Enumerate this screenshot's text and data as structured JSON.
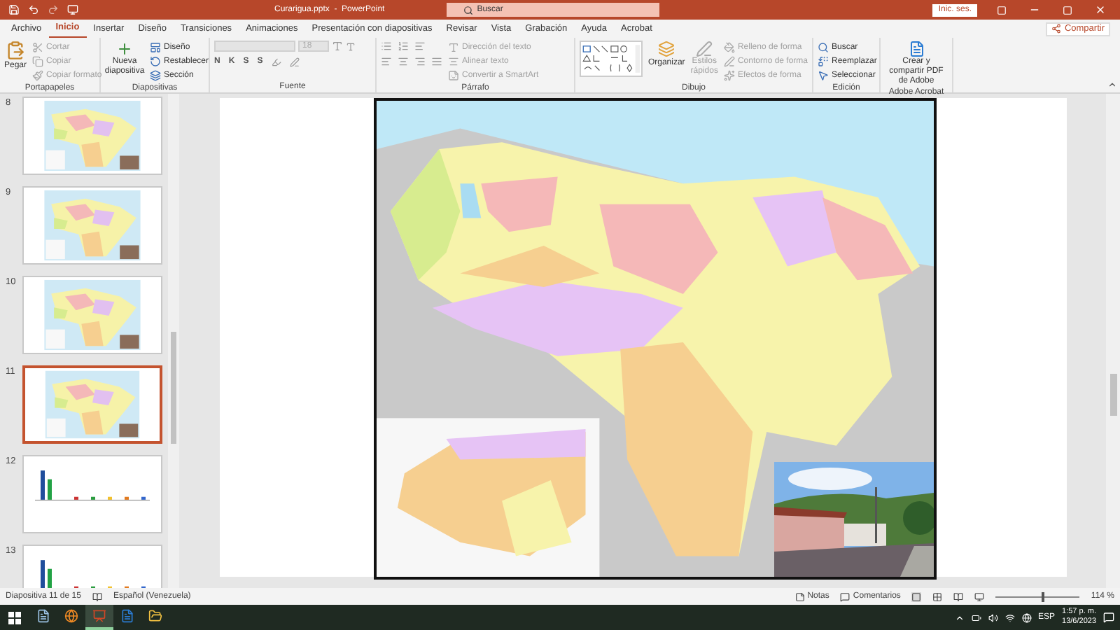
{
  "title_bar": {
    "file_title": "Curarigua.pptx  -  PowerPoint",
    "search_placeholder": "Buscar",
    "sign_in": "Inic. ses."
  },
  "menu_tabs": [
    {
      "label": "Archivo",
      "selected": false
    },
    {
      "label": "Inicio",
      "selected": true
    },
    {
      "label": "Insertar",
      "selected": false
    },
    {
      "label": "Diseño",
      "selected": false
    },
    {
      "label": "Transiciones",
      "selected": false
    },
    {
      "label": "Animaciones",
      "selected": false
    },
    {
      "label": "Presentación con diapositivas",
      "selected": false
    },
    {
      "label": "Revisar",
      "selected": false
    },
    {
      "label": "Vista",
      "selected": false
    },
    {
      "label": "Grabación",
      "selected": false
    },
    {
      "label": "Ayuda",
      "selected": false
    },
    {
      "label": "Acrobat",
      "selected": false
    }
  ],
  "share_button": "Compartir",
  "ribbon": {
    "portapapeles": {
      "label": "Portapapeles",
      "paste": "Pegar",
      "items": [
        {
          "label": "Cortar",
          "disabled": true
        },
        {
          "label": "Copiar",
          "disabled": true
        },
        {
          "label": "Copiar formato",
          "disabled": true
        }
      ]
    },
    "diapositivas": {
      "label": "Diapositivas",
      "new_slide": "Nueva diapositiva",
      "items": [
        {
          "label": "Diseño",
          "disabled": false
        },
        {
          "label": "Restablecer",
          "disabled": false
        },
        {
          "label": "Sección",
          "disabled": false
        }
      ]
    },
    "fuente": {
      "label": "Fuente",
      "font_size": "18",
      "format_letters": [
        "N",
        "K",
        "S",
        "S"
      ]
    },
    "parrafo": {
      "label": "Párrafo",
      "items": [
        {
          "label": "Dirección del texto",
          "disabled": true
        },
        {
          "label": "Alinear texto",
          "disabled": true
        },
        {
          "label": "Convertir a SmartArt",
          "disabled": true
        }
      ]
    },
    "dibujo": {
      "label": "Dibujo",
      "arrange": "Organizar",
      "quick_styles": "Estilos rápidos",
      "items": [
        {
          "label": "Relleno de forma",
          "disabled": true
        },
        {
          "label": "Contorno de forma",
          "disabled": true
        },
        {
          "label": "Efectos de forma",
          "disabled": true
        }
      ]
    },
    "edicion": {
      "label": "Edición",
      "items": [
        {
          "label": "Buscar",
          "disabled": false
        },
        {
          "label": "Reemplazar",
          "disabled": false
        },
        {
          "label": "Seleccionar",
          "disabled": false
        }
      ]
    },
    "acrobat": {
      "label": "Adobe Acrobat",
      "create": "Crear y compartir PDF de Adobe"
    }
  },
  "slides": [
    {
      "number": "8",
      "kind": "map",
      "selected": false
    },
    {
      "number": "9",
      "kind": "map",
      "selected": false
    },
    {
      "number": "10",
      "kind": "map",
      "selected": false
    },
    {
      "number": "11",
      "kind": "map",
      "selected": true
    },
    {
      "number": "12",
      "kind": "chart",
      "selected": false
    },
    {
      "number": "13",
      "kind": "chart",
      "selected": false
    }
  ],
  "status_bar": {
    "slide_count": "Diapositiva 11 de 15",
    "language": "Español (Venezuela)",
    "notes": "Notas",
    "comments": "Comentarios",
    "zoom": "114 %",
    "zoom_slider": {
      "level": 0.55
    }
  },
  "taskbar": {
    "apps": [
      {
        "kind": "files",
        "selected": false
      },
      {
        "kind": "browser",
        "selected": false
      },
      {
        "kind": "powerpoint",
        "selected": true
      },
      {
        "kind": "word",
        "selected": false
      },
      {
        "kind": "folder",
        "selected": false
      }
    ],
    "language": "ESP",
    "time": "1:57 p. m.",
    "date": "13/6/2023"
  }
}
